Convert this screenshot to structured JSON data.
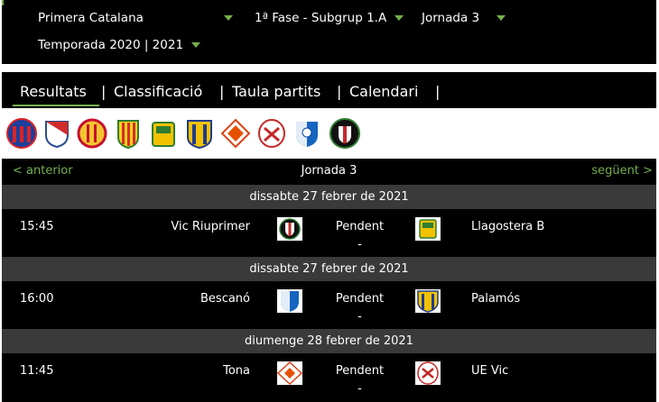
{
  "filters": {
    "competition": "Primera Catalana",
    "phase": "1ª Fase - Subgrup 1.A",
    "round": "Jornada 3",
    "season": "Temporada 2020 | 2021"
  },
  "tabs": [
    {
      "label": "Resultats",
      "active": true
    },
    {
      "label": "Classificació",
      "active": false
    },
    {
      "label": "Taula partits",
      "active": false
    },
    {
      "label": "Calendari",
      "active": false
    }
  ],
  "tab_separator": "|",
  "team_logos": [
    "team-crest-red-blue-stripes-icon",
    "team-crest-white-red-shield-icon",
    "team-crest-red-yellow-round-icon",
    "team-crest-yellow-red-stripes-icon",
    "team-crest-yellow-green-icon",
    "team-crest-yellow-blue-stripes-icon",
    "team-crest-red-orange-diamond-icon",
    "team-crest-white-red-oval-icon",
    "team-crest-blue-white-icon",
    "team-crest-black-green-round-icon"
  ],
  "results": {
    "prev_label": "< anterior",
    "next_label": "següent >",
    "round_title": "Jornada 3",
    "days": [
      {
        "date": "dissabte 27 febrer de 2021",
        "match": {
          "time": "15:45",
          "home": "Vic Riuprimer",
          "status": "Pendent",
          "score": "-",
          "away": "Llagostera B"
        }
      },
      {
        "date": "dissabte 27 febrer de 2021",
        "match": {
          "time": "16:00",
          "home": "Bescanó",
          "status": "Pendent",
          "score": "-",
          "away": "Palamós"
        }
      },
      {
        "date": "diumenge 28 febrer de 2021",
        "match": {
          "time": "11:45",
          "home": "Tona",
          "status": "Pendent",
          "score": "-",
          "away": "UE Vic"
        }
      }
    ]
  },
  "colors": {
    "accent": "#73b04c",
    "bar": "#000000",
    "date_bar": "#3a3a3a"
  }
}
